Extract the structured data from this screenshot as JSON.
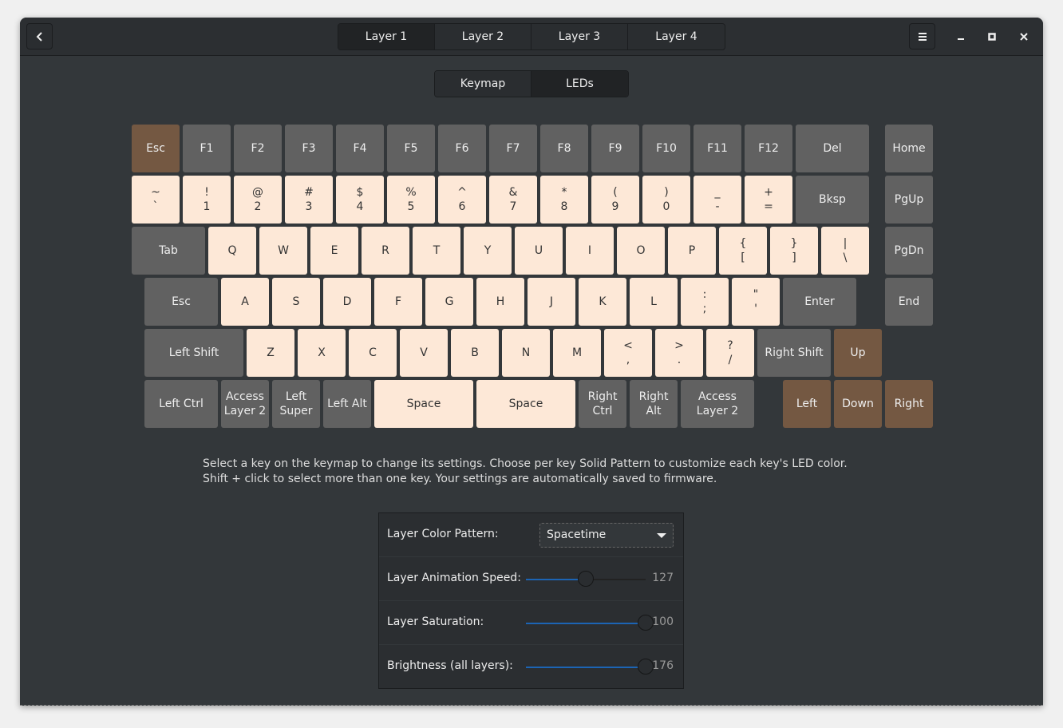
{
  "header": {
    "back_icon": "chevron-left-icon",
    "layers": [
      "Layer 1",
      "Layer 2",
      "Layer 3",
      "Layer 4"
    ],
    "active_layer": 0,
    "menu_icon": "hamburger-icon",
    "minimize_icon": "minimize-icon",
    "maximize_icon": "maximize-icon",
    "close_icon": "close-icon"
  },
  "view_tabs": {
    "items": [
      "Keymap",
      "LEDs"
    ],
    "active": 1
  },
  "colors": {
    "gray": "#616161",
    "cream": "#fde8d7",
    "brown": "#745842",
    "accent": "#1c64b4"
  },
  "keyboard": {
    "rows": [
      [
        [
          "Esc",
          "brown"
        ],
        [
          "F1",
          "gray"
        ],
        [
          "F2",
          "gray"
        ],
        [
          "F3",
          "gray"
        ],
        [
          "F4",
          "gray"
        ],
        [
          "F5",
          "gray"
        ],
        [
          "F6",
          "gray"
        ],
        [
          "F7",
          "gray"
        ],
        [
          "F8",
          "gray"
        ],
        [
          "F9",
          "gray"
        ],
        [
          "F10",
          "gray"
        ],
        [
          "F11",
          "gray"
        ],
        [
          "F12",
          "gray"
        ],
        [
          "Del",
          "gray"
        ],
        [
          "Home",
          "gray"
        ]
      ],
      [
        [
          "~\n`",
          "cream"
        ],
        [
          "!\n1",
          "cream"
        ],
        [
          "@\n2",
          "cream"
        ],
        [
          "#\n3",
          "cream"
        ],
        [
          "$\n4",
          "cream"
        ],
        [
          "%\n5",
          "cream"
        ],
        [
          "^\n6",
          "cream"
        ],
        [
          "&\n7",
          "cream"
        ],
        [
          "*\n8",
          "cream"
        ],
        [
          "(\n9",
          "cream"
        ],
        [
          ")\n0",
          "cream"
        ],
        [
          "_\n-",
          "cream"
        ],
        [
          "+\n=",
          "cream"
        ],
        [
          "Bksp",
          "gray"
        ],
        [
          "PgUp",
          "gray"
        ]
      ],
      [
        [
          "Tab",
          "gray"
        ],
        [
          "Q",
          "cream"
        ],
        [
          "W",
          "cream"
        ],
        [
          "E",
          "cream"
        ],
        [
          "R",
          "cream"
        ],
        [
          "T",
          "cream"
        ],
        [
          "Y",
          "cream"
        ],
        [
          "U",
          "cream"
        ],
        [
          "I",
          "cream"
        ],
        [
          "O",
          "cream"
        ],
        [
          "P",
          "cream"
        ],
        [
          "{\n[",
          "cream"
        ],
        [
          "}\n]",
          "cream"
        ],
        [
          "|\n\\",
          "cream"
        ],
        [
          "PgDn",
          "gray"
        ]
      ],
      [
        [
          "Esc",
          "gray"
        ],
        [
          "A",
          "cream"
        ],
        [
          "S",
          "cream"
        ],
        [
          "D",
          "cream"
        ],
        [
          "F",
          "cream"
        ],
        [
          "G",
          "cream"
        ],
        [
          "H",
          "cream"
        ],
        [
          "J",
          "cream"
        ],
        [
          "K",
          "cream"
        ],
        [
          "L",
          "cream"
        ],
        [
          ":\n;",
          "cream"
        ],
        [
          "\"\n'",
          "cream"
        ],
        [
          "Enter",
          "gray"
        ],
        [
          "End",
          "gray"
        ]
      ],
      [
        [
          "Left Shift",
          "gray"
        ],
        [
          "Z",
          "cream"
        ],
        [
          "X",
          "cream"
        ],
        [
          "C",
          "cream"
        ],
        [
          "V",
          "cream"
        ],
        [
          "B",
          "cream"
        ],
        [
          "N",
          "cream"
        ],
        [
          "M",
          "cream"
        ],
        [
          "<\n,",
          "cream"
        ],
        [
          ">\n.",
          "cream"
        ],
        [
          "?\n/",
          "cream"
        ],
        [
          "Right Shift",
          "gray"
        ],
        [
          "Up",
          "brown"
        ]
      ],
      [
        [
          "Left Ctrl",
          "gray"
        ],
        [
          "Access\nLayer 2",
          "gray"
        ],
        [
          "Left\nSuper",
          "gray"
        ],
        [
          "Left Alt",
          "gray"
        ],
        [
          "Space",
          "cream"
        ],
        [
          "Space",
          "cream"
        ],
        [
          "Right\nCtrl",
          "gray"
        ],
        [
          "Right Alt",
          "gray"
        ],
        [
          "Access\nLayer 2",
          "gray"
        ],
        [
          "Left",
          "brown"
        ],
        [
          "Down",
          "brown"
        ],
        [
          "Right",
          "brown"
        ]
      ]
    ]
  },
  "help_text": "Select a key on the keymap to change its settings. Choose per key Solid Pattern to customize each key's LED color. Shift + click to select more than one key. Your settings are automatically saved to firmware.",
  "settings": {
    "pattern": {
      "label": "Layer Color Pattern:",
      "value": "Spacetime"
    },
    "sliders": [
      {
        "label": "Layer Animation Speed:",
        "value": "127",
        "fraction": 0.5
      },
      {
        "label": "Layer Saturation:",
        "value": "100",
        "fraction": 1.0
      },
      {
        "label": "Brightness (all layers):",
        "value": "176",
        "fraction": 1.0
      }
    ]
  }
}
